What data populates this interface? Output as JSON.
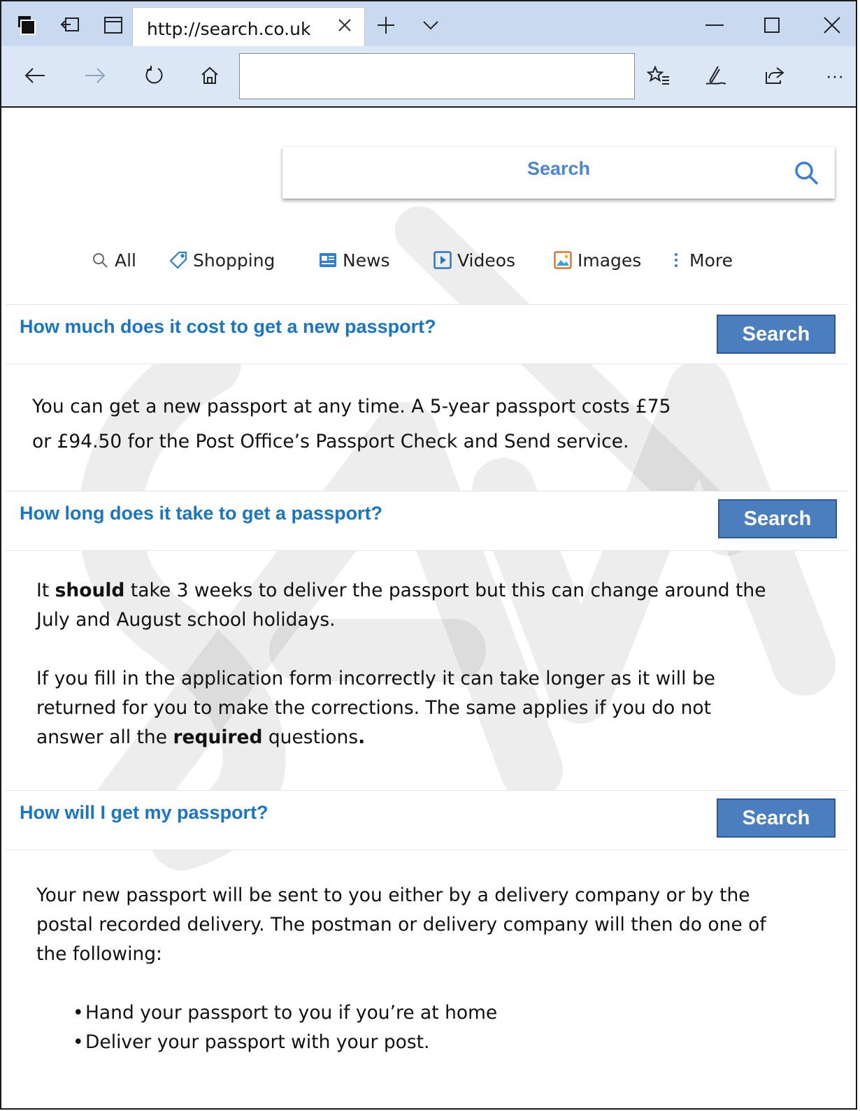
{
  "browser": {
    "tab_title": "http://search.co.uk",
    "address_value": "",
    "more_label": "···"
  },
  "search": {
    "placeholder": "Search"
  },
  "filters": [
    {
      "label": "All",
      "icon": "search-icon"
    },
    {
      "label": "Shopping",
      "icon": "tag-icon"
    },
    {
      "label": "News",
      "icon": "news-icon"
    },
    {
      "label": "Videos",
      "icon": "play-icon"
    },
    {
      "label": "Images",
      "icon": "image-icon"
    },
    {
      "label": "More",
      "icon": "kebab-icon"
    }
  ],
  "sections": [
    {
      "question": "How much does it cost to get a new passport?",
      "button": "Search",
      "answer_line1": "You can get a new passport at any time. A 5-year passport costs £75",
      "answer_line2": "or £94.50 for the Post Office’s Passport Check and Send service."
    },
    {
      "question": "How long does it take to get a passport?",
      "button": "Search",
      "p1_before": "It ",
      "p1_bold": "should",
      "p1_after_line1": " take 3 weeks to deliver the passport but this can change around the",
      "p1_line2": "July and August school holidays.",
      "p2_line1": "If you fill in the application form incorrectly it can take longer as it will be",
      "p2_line2": "returned for you to make the corrections. The same applies if you do not",
      "p2_line3_before": "answer all the ",
      "p2_line3_bold": "required",
      "p2_line3_after": " questions",
      "p2_line3_end": "."
    },
    {
      "question": "How will I get my passport?",
      "button": "Search",
      "line1": "Your new passport will be sent to you either by a delivery company or by the",
      "line2": "postal recorded delivery. The postman or delivery company will then do one of",
      "line3": "the following:",
      "bullets": [
        "Hand your passport to you if you’re at home",
        "Deliver your passport with your post."
      ]
    }
  ],
  "colors": {
    "accent": "#1976c6",
    "button": "#4a7ebf",
    "chrome_tabbar": "#c9daf0",
    "chrome_navbar": "#dbe7f5"
  }
}
